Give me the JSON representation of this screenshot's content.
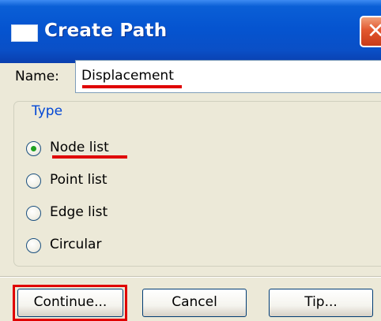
{
  "window": {
    "title": "Create Path",
    "close_glyph": "✕"
  },
  "name": {
    "label": "Name:",
    "value": "Displacement"
  },
  "type_group": {
    "legend": "Type",
    "options": [
      {
        "label": "Node list",
        "selected": true
      },
      {
        "label": "Point list",
        "selected": false
      },
      {
        "label": "Edge list",
        "selected": false
      },
      {
        "label": "Circular",
        "selected": false
      }
    ]
  },
  "buttons": {
    "continue": "Continue...",
    "cancel": "Cancel",
    "tip": "Tip..."
  },
  "colors": {
    "annotation_red": "#e00000",
    "title_blue": "#0554d0",
    "legend_blue": "#0046d5",
    "radio_selected_green": "#21a121"
  },
  "icons": {
    "app": "window-icon",
    "close": "close-icon"
  }
}
